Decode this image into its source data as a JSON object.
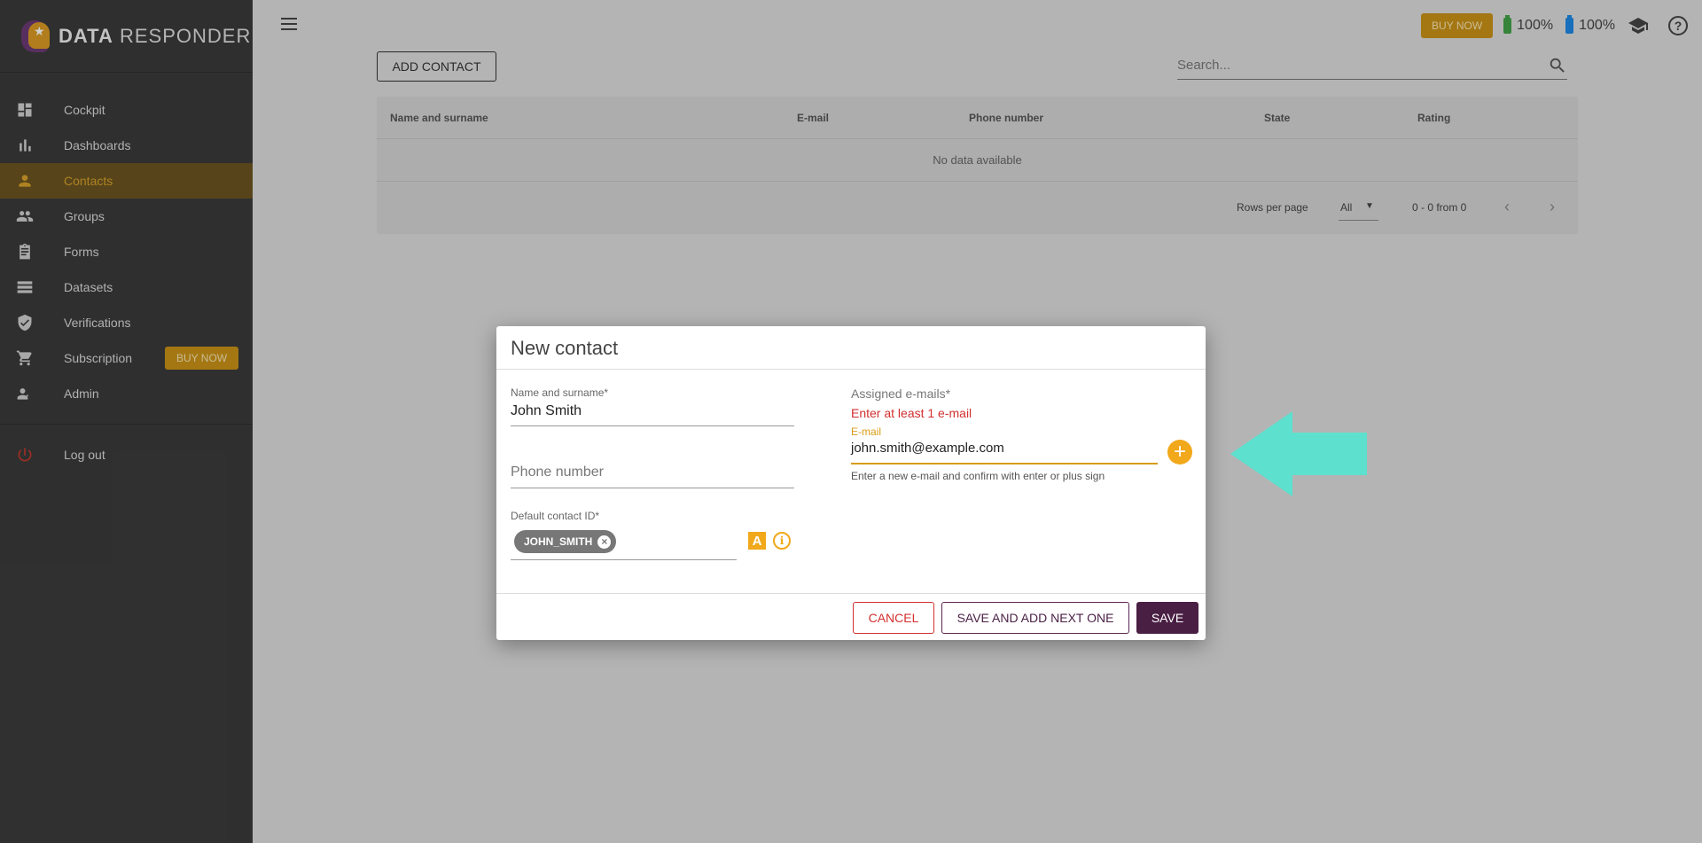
{
  "app": {
    "logo_data": "DATA",
    "logo_responder": "RESPONDER"
  },
  "sidebar": {
    "items": [
      {
        "label": "Cockpit",
        "icon": "dashboard-icon"
      },
      {
        "label": "Dashboards",
        "icon": "bar-chart-icon"
      },
      {
        "label": "Contacts",
        "icon": "person-icon",
        "active": true
      },
      {
        "label": "Groups",
        "icon": "people-icon"
      },
      {
        "label": "Forms",
        "icon": "clipboard-icon"
      },
      {
        "label": "Datasets",
        "icon": "list-icon"
      },
      {
        "label": "Verifications",
        "icon": "shield-check-icon"
      },
      {
        "label": "Subscription",
        "icon": "cart-icon",
        "badge": "BUY NOW"
      },
      {
        "label": "Admin",
        "icon": "admin-icon"
      }
    ],
    "logout": "Log out"
  },
  "topbar": {
    "buy_now": "BUY NOW",
    "battery1": "100%",
    "battery2": "100%",
    "battery1_color": "#43a047",
    "battery2_color": "#1e88e5"
  },
  "main": {
    "add_contact": "ADD CONTACT",
    "search_placeholder": "Search...",
    "columns": [
      "Name and surname",
      "E-mail",
      "Phone number",
      "State",
      "Rating"
    ],
    "empty_text": "No data available",
    "rows_per_page_label": "Rows per page",
    "rows_per_page_value": "All",
    "range_text": "0 - 0 from 0"
  },
  "dialog": {
    "title": "New contact",
    "name_label": "Name and surname*",
    "name_value": "John Smith",
    "phone_placeholder": "Phone number",
    "default_id_label": "Default contact ID*",
    "chip_value": "JOHN_SMITH",
    "a_button": "A",
    "info_button": "i",
    "emails_label": "Assigned e-mails*",
    "emails_error": "Enter at least 1 e-mail",
    "email_field_label": "E-mail",
    "email_value": "john.smith@example.com",
    "email_hint": "Enter a new e-mail and confirm with enter or plus sign",
    "cancel": "CANCEL",
    "save_next": "SAVE AND ADD NEXT ONE",
    "save": "SAVE"
  },
  "colors": {
    "accent": "#f1a81a",
    "primary": "#4a1f44",
    "error": "#d32f2f",
    "arrow": "#5ee0cf"
  }
}
